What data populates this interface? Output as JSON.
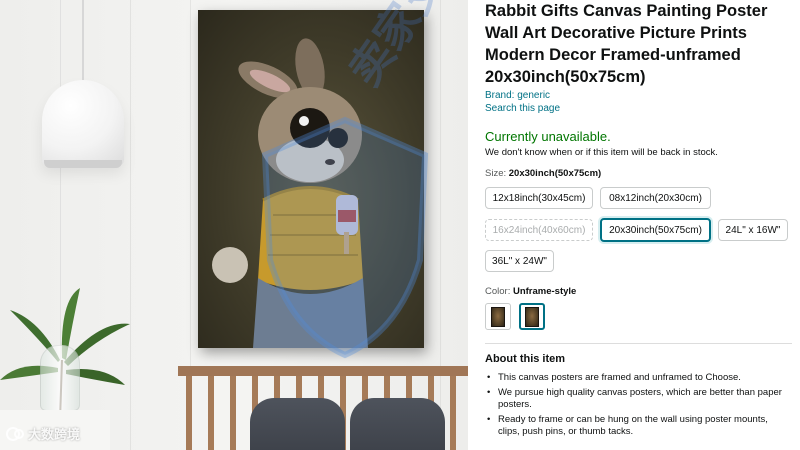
{
  "product": {
    "title": "Rabbit Gifts Canvas Painting Poster Wall Art Decorative Picture Prints Modern Decor Framed-unframed 20x30inch(50x75cm)",
    "brand_link": "Brand: generic",
    "search_link": "Search this page"
  },
  "availability": {
    "status": "Currently unavailable.",
    "note": "We don't know when or if this item will be back in stock."
  },
  "size": {
    "label": "Size:",
    "selected": "20x30inch(50x75cm)",
    "options": [
      "12x18inch(30x45cm)",
      "08x12inch(20x30cm)",
      "16x24inch(40x60cm)",
      "20x30inch(50x75cm)",
      "24L\" x 16W\"",
      "36L\" x 24W\""
    ]
  },
  "color": {
    "label": "Color:",
    "selected": "Unframe-style"
  },
  "about": {
    "heading": "About this item",
    "bullets": [
      "This canvas posters are framed and unframed to Choose.",
      "We pursue high quality canvas posters, which are better than paper posters.",
      "Ready to frame or can be hung on the wall using poster mounts, clips, push pins, or thumb tacks."
    ]
  },
  "watermark": {
    "corner_text": "大数跨境",
    "overlay_text": "卖家支持"
  },
  "colors": {
    "link": "#007185",
    "in_stock_green": "#007600",
    "selected_border": "#007185",
    "text": "#0f1111"
  }
}
